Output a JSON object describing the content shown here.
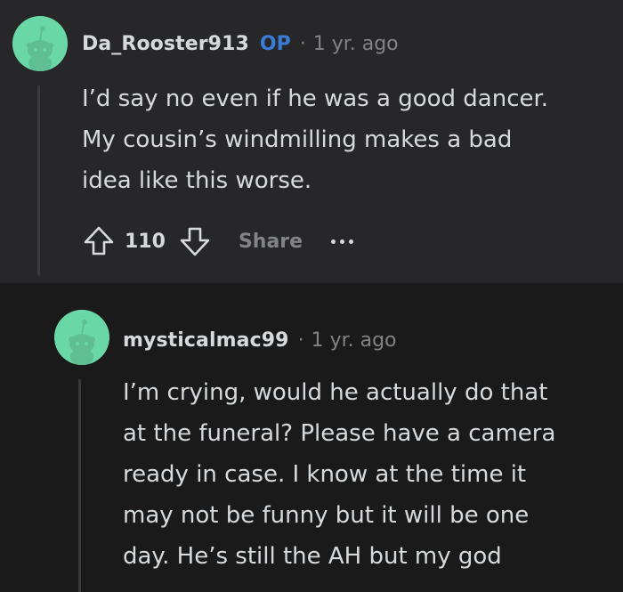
{
  "parent_comment": {
    "username": "Da_Rooster913",
    "badge": "OP",
    "separator": "·",
    "time": "1 yr. ago",
    "avatar_icon": "reddit-snoo-avatar-icon",
    "body_lines": [
      "I’d say no even if he was a good dancer.",
      "My cousin’s windmilling makes a bad",
      "idea like this worse."
    ],
    "actions": {
      "upvote_icon": "upvote-arrow-icon",
      "score": "110",
      "downvote_icon": "downvote-arrow-icon",
      "share_label": "Share",
      "more_icon": "more-options-icon"
    }
  },
  "reply_comment": {
    "username": "mysticalmac99",
    "separator": "·",
    "time": "1 yr. ago",
    "avatar_icon": "reddit-snoo-avatar-icon",
    "body_lines": [
      "I’m crying, would he actually do that",
      "at the funeral? Please have a camera",
      "ready in case. I know at the time it",
      "may not be funny but it will be one",
      "day. He’s still the AH but my god"
    ]
  },
  "colors": {
    "top_comment_bg": "#272729",
    "reply_bg": "#1a1a1b",
    "avatar_bg": "#6ad7a6",
    "text": "#d7dadc",
    "muted": "#818384",
    "op_badge": "#3a7bd5",
    "thread_line": "#3a3a3c"
  }
}
